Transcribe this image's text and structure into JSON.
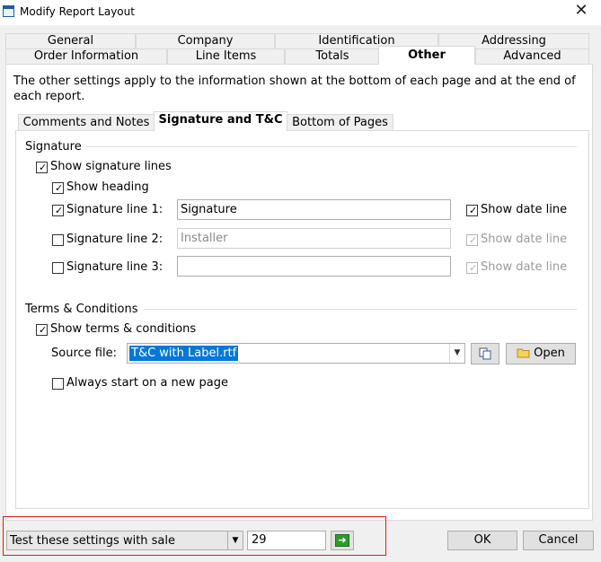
{
  "window": {
    "title": "Modify Report Layout",
    "close_glyph": "✕",
    "icon": "window-icon"
  },
  "tabs_row1": [
    "General",
    "Company",
    "Identification",
    "Addressing"
  ],
  "tabs_row2": [
    "Order Information",
    "Line Items",
    "Totals",
    "Other",
    "Advanced"
  ],
  "active_tab": "Other",
  "description": "The other settings apply to the information shown at the bottom of each page and at the end of each report.",
  "inner_tabs": [
    "Comments and Notes",
    "Signature and T&C",
    "Bottom of Pages"
  ],
  "active_inner_tab": "Signature and T&C",
  "signature": {
    "group_label": "Signature",
    "show_lines_label": "Show signature lines",
    "show_heading_label": "Show heading",
    "line1_label": "Signature line 1:",
    "line1_value": "Signature",
    "line1_date_label": "Show date line",
    "line2_label": "Signature line 2:",
    "line2_placeholder": "Installer",
    "line2_date_label": "Show date line",
    "line3_label": "Signature line 3:",
    "line3_value": "",
    "line3_date_label": "Show date line"
  },
  "terms": {
    "group_label": "Terms & Conditions",
    "show_terms_label": "Show terms & conditions",
    "source_label": "Source file:",
    "source_value": "T&C with Label.rtf",
    "open_label": "Open",
    "new_page_label": "Always start on a new page"
  },
  "bottom": {
    "test_label": "Test these settings with sale",
    "sale_number": "29",
    "ok_label": "OK",
    "cancel_label": "Cancel"
  },
  "colors": {
    "selection": "#0078d7",
    "highlight_border": "#e01919",
    "go_icon": "#2c9b2c"
  }
}
